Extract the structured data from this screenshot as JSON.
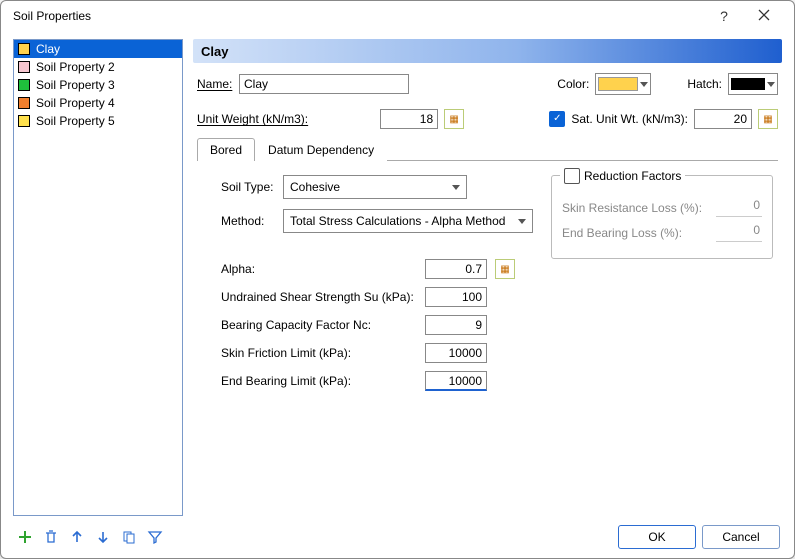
{
  "window": {
    "title": "Soil Properties"
  },
  "sidebar": {
    "items": [
      {
        "label": "Clay",
        "swatch": "#ffd24d",
        "selected": true
      },
      {
        "label": "Soil Property 2",
        "swatch": "#f6c6d0",
        "selected": false
      },
      {
        "label": "Soil Property 3",
        "swatch": "#1fbf3c",
        "selected": false
      },
      {
        "label": "Soil Property 4",
        "swatch": "#f07f2e",
        "selected": false
      },
      {
        "label": "Soil Property 5",
        "swatch": "#ffe14d",
        "selected": false
      }
    ]
  },
  "heading": "Clay",
  "top": {
    "name_label": "Name:",
    "name_value": "Clay",
    "color_label": "Color:",
    "color_value": "#ffd24d",
    "hatch_label": "Hatch:",
    "hatch_value": "#000000",
    "unit_weight_label": "Unit Weight (kN/m3):",
    "unit_weight_value": "18",
    "sat_unit_label": "Sat. Unit Wt. (kN/m3):",
    "sat_unit_value": "20",
    "sat_unit_checked": true
  },
  "tabs": {
    "bored": "Bored",
    "datum": "Datum Dependency",
    "active": "bored"
  },
  "bored": {
    "soil_type_label": "Soil Type:",
    "soil_type_value": "Cohesive",
    "method_label": "Method:",
    "method_value": "Total Stress Calculations - Alpha Method",
    "reduction_title": "Reduction Factors",
    "reduction_checked": false,
    "skin_loss_label": "Skin Resistance Loss (%):",
    "skin_loss_value": "0",
    "end_loss_label": "End Bearing Loss (%):",
    "end_loss_value": "0",
    "params": [
      {
        "label": "Alpha:",
        "value": "0.7",
        "icon": true
      },
      {
        "label": "Undrained Shear Strength Su (kPa):",
        "value": "100",
        "icon": false
      },
      {
        "label": "Bearing Capacity Factor Nc:",
        "value": "9",
        "icon": false
      },
      {
        "label": "Skin Friction Limit (kPa):",
        "value": "10000",
        "icon": false
      },
      {
        "label": "End Bearing Limit (kPa):",
        "value": "10000",
        "icon": false
      }
    ]
  },
  "footer": {
    "ok": "OK",
    "cancel": "Cancel"
  }
}
